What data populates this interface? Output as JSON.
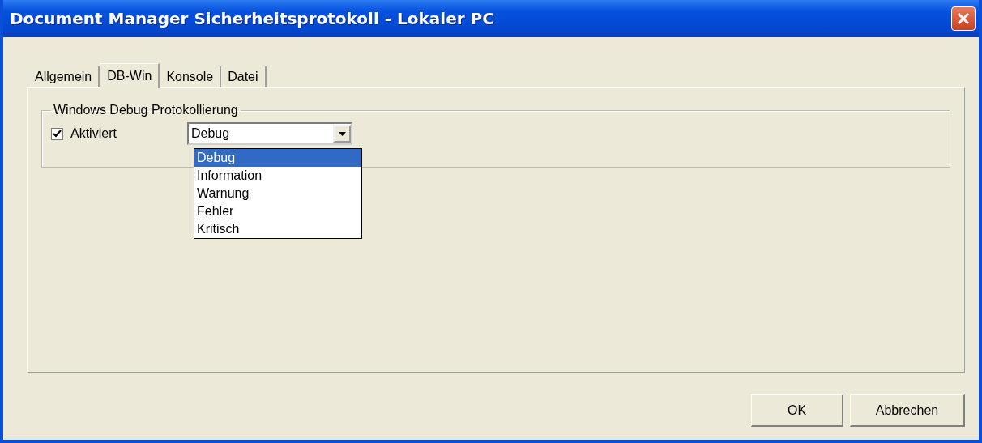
{
  "window": {
    "title": "Document Manager Sicherheitsprotokoll - Lokaler PC"
  },
  "tabs": [
    {
      "label": "Allgemein",
      "selected": false
    },
    {
      "label": "DB-Win",
      "selected": true
    },
    {
      "label": "Konsole",
      "selected": false
    },
    {
      "label": "Datei",
      "selected": false
    }
  ],
  "group": {
    "title": "Windows Debug Protokollierung"
  },
  "enabled": {
    "label": "Aktiviert",
    "checked": true
  },
  "level_combo": {
    "value": "Debug",
    "expanded": true,
    "options": [
      {
        "label": "Debug",
        "selected": true
      },
      {
        "label": "Information",
        "selected": false
      },
      {
        "label": "Warnung",
        "selected": false
      },
      {
        "label": "Fehler",
        "selected": false
      },
      {
        "label": "Kritisch",
        "selected": false
      }
    ]
  },
  "buttons": [
    "OK",
    "Abbrechen"
  ]
}
